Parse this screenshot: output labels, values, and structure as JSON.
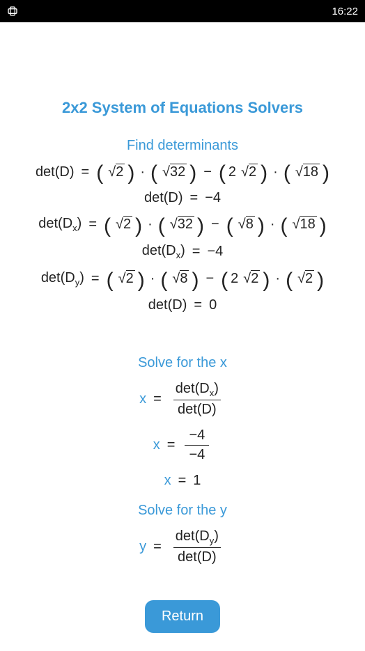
{
  "status": {
    "time": "16:22"
  },
  "title": "2x2 System of Equations Solvers",
  "sections": {
    "det_label": "Find determinants",
    "solve_x_label": "Solve for the x",
    "solve_y_label": "Solve for the y"
  },
  "equations": {
    "detD": {
      "lhs": "det(D)",
      "a": "2",
      "b": "32",
      "c_coef": "2",
      "c": "2",
      "d": "18",
      "result": "−4"
    },
    "detDx": {
      "lhs_base": "det(D",
      "lhs_sub": "x",
      "lhs_close": ")",
      "a": "2",
      "b": "32",
      "c": "8",
      "d": "18",
      "result": "−4"
    },
    "detDy": {
      "lhs_base": "det(D",
      "lhs_sub": "y",
      "lhs_close": ")",
      "a": "2",
      "b": "8",
      "c_coef": "2",
      "c": "2",
      "d": "2",
      "result_lhs": "det(D)",
      "result": "0"
    },
    "solve_x": {
      "var": "x",
      "num_base": "det(D",
      "num_sub": "x",
      "num_close": ")",
      "den": "det(D)",
      "num_val": "−4",
      "den_val": "−4",
      "final": "1"
    },
    "solve_y": {
      "var": "y",
      "num_base": "det(D",
      "num_sub": "y",
      "num_close": ")",
      "den": "det(D)"
    }
  },
  "return_label": "Return",
  "glyphs": {
    "eq": "=",
    "minus": "−",
    "dot": "·"
  }
}
